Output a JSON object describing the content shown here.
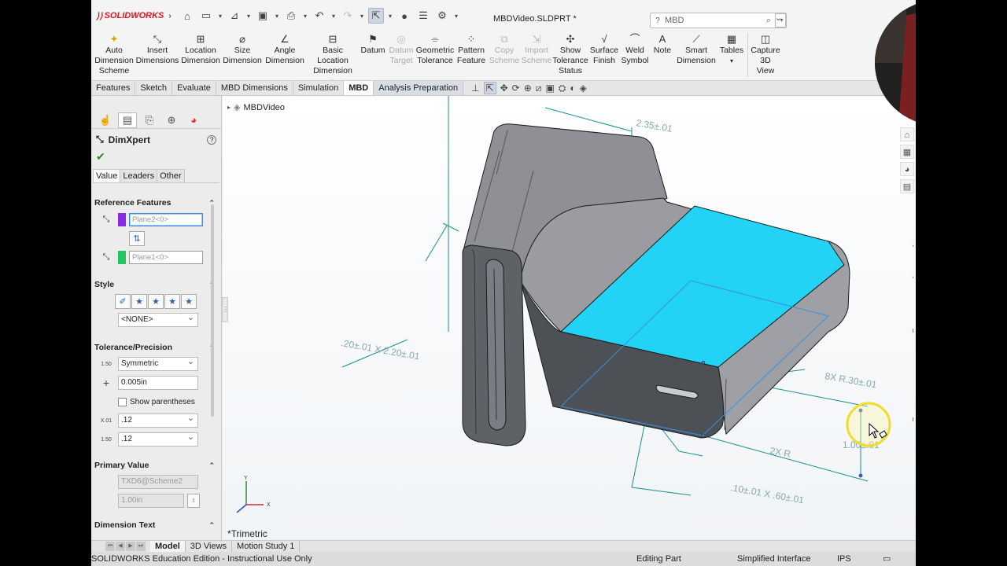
{
  "titlebar": {
    "brand": "SOLIDWORKS",
    "document_title": "MBDVideo.SLDPRT *",
    "search_placeholder": "MBD"
  },
  "ribbon": {
    "buttons": [
      {
        "label": "Auto Dimension Scheme",
        "icon": "auto-dimension-icon",
        "enabled": true
      },
      {
        "label": "Insert Dimensions",
        "icon": "insert-dimensions-icon",
        "enabled": true
      },
      {
        "label": "Location Dimension",
        "icon": "location-dimension-icon",
        "enabled": true
      },
      {
        "label": "Size Dimension",
        "icon": "size-dimension-icon",
        "enabled": true
      },
      {
        "label": "Angle Dimension",
        "icon": "angle-dimension-icon",
        "enabled": true
      },
      {
        "label": "Basic Location Dimension",
        "icon": "basic-location-icon",
        "enabled": true
      },
      {
        "label": "Datum",
        "icon": "datum-icon",
        "enabled": true
      },
      {
        "label": "Datum Target",
        "icon": "datum-target-icon",
        "enabled": false
      },
      {
        "label": "Geometric Tolerance",
        "icon": "geometric-tolerance-icon",
        "enabled": true
      },
      {
        "label": "Pattern Feature",
        "icon": "pattern-feature-icon",
        "enabled": true
      },
      {
        "label": "Copy Scheme",
        "icon": "copy-scheme-icon",
        "enabled": false
      },
      {
        "label": "Import Scheme",
        "icon": "import-scheme-icon",
        "enabled": false
      },
      {
        "label": "Show Tolerance Status",
        "icon": "tolerance-status-icon",
        "enabled": true
      },
      {
        "label": "Surface Finish",
        "icon": "surface-finish-icon",
        "enabled": true
      },
      {
        "label": "Weld Symbol",
        "icon": "weld-symbol-icon",
        "enabled": true
      },
      {
        "label": "Note",
        "icon": "note-icon",
        "enabled": true
      },
      {
        "label": "Smart Dimension",
        "icon": "smart-dimension-icon",
        "enabled": true
      },
      {
        "label": "Tables",
        "icon": "tables-icon",
        "enabled": true
      },
      {
        "label": "Capture 3D View",
        "icon": "capture-view-icon",
        "enabled": true
      }
    ]
  },
  "command_tabs": [
    "Features",
    "Sketch",
    "Evaluate",
    "MBD Dimensions",
    "Simulation",
    "MBD",
    "Analysis Preparation"
  ],
  "property_manager": {
    "title": "DimXpert",
    "subtabs": [
      "Value",
      "Leaders",
      "Other"
    ],
    "reference_features": {
      "heading": "Reference Features",
      "ref1": "Plane2<0>",
      "ref2": "Plane1<0>",
      "ref1_color": "#8a2be2",
      "ref2_color": "#22c55e"
    },
    "style": {
      "heading": "Style",
      "value": "<NONE>"
    },
    "tolerance": {
      "heading": "Tolerance/Precision",
      "type": "Symmetric",
      "plus_value": "0.005in",
      "show_parentheses": "Show parentheses",
      "precision1": ".12",
      "precision2": ".12"
    },
    "primary_value": {
      "heading": "Primary Value",
      "name": "TXD6@Scheme2",
      "value": "1.00in"
    },
    "dimension_text": {
      "heading": "Dimension Text"
    }
  },
  "viewport": {
    "tree_root": "MBDVideo",
    "view_name": "*Trimetric",
    "highlight_color": "#22d3f5",
    "annotations": {
      "top_dim": "2.35±.01",
      "slot_dim": ".20±.01 X 2.20±.01",
      "radius_dim": "8X R.30±.01",
      "small_r": "2X R",
      "slot2_dim": ".10±.01 X .60±.01",
      "side_dim": "1.00±.01"
    }
  },
  "bottom_tabs": [
    "Model",
    "3D Views",
    "Motion Study 1"
  ],
  "status": {
    "edition": "SOLIDWORKS Education Edition - Instructional Use Only",
    "mode": "Editing Part",
    "interface": "Simplified Interface",
    "units": "IPS"
  }
}
